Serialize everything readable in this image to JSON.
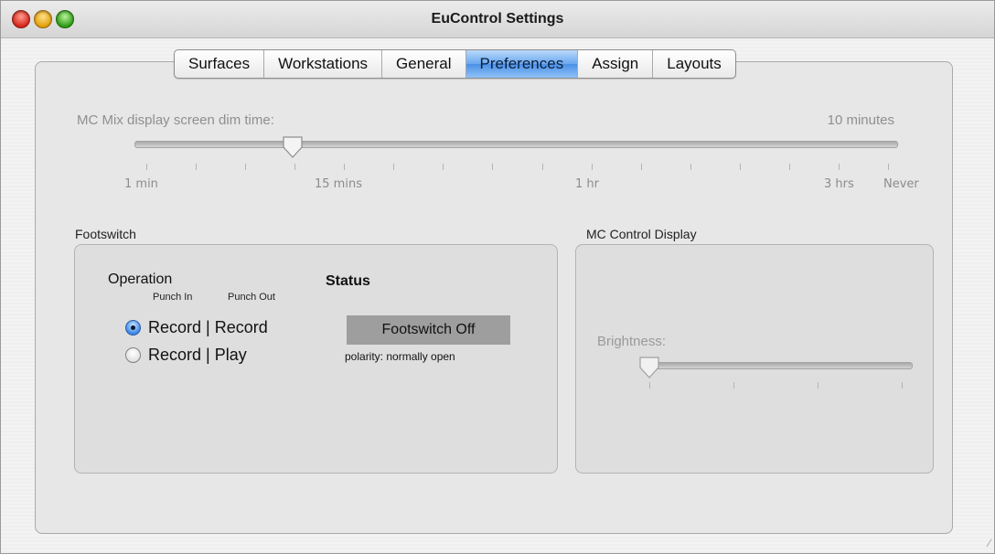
{
  "window": {
    "title": "EuControl Settings"
  },
  "tabs": [
    {
      "label": "Surfaces",
      "active": false
    },
    {
      "label": "Workstations",
      "active": false
    },
    {
      "label": "General",
      "active": false
    },
    {
      "label": "Preferences",
      "active": true
    },
    {
      "label": "Assign",
      "active": false
    },
    {
      "label": "Layouts",
      "active": false
    }
  ],
  "dim_time": {
    "label": "MC Mix display screen dim time:",
    "value": "10 minutes",
    "scale_labels": [
      "1 min",
      "15 mins",
      "1 hr",
      "3 hrs",
      "Never"
    ]
  },
  "footswitch": {
    "group_title": "Footswitch",
    "operation_label": "Operation",
    "punch_in_label": "Punch In",
    "punch_out_label": "Punch Out",
    "status_label": "Status",
    "options": [
      {
        "label": "Record | Record",
        "checked": true
      },
      {
        "label": "Record | Play",
        "checked": false
      }
    ],
    "status_value": "Footswitch Off",
    "polarity": "polarity: normally open"
  },
  "mc_control": {
    "group_title": "MC Control Display",
    "brightness_label": "Brightness:"
  },
  "colors": {
    "active_tab": "#4b90e6",
    "disabled_text": "#8f8f8f",
    "status_box": "#9e9e9e"
  }
}
